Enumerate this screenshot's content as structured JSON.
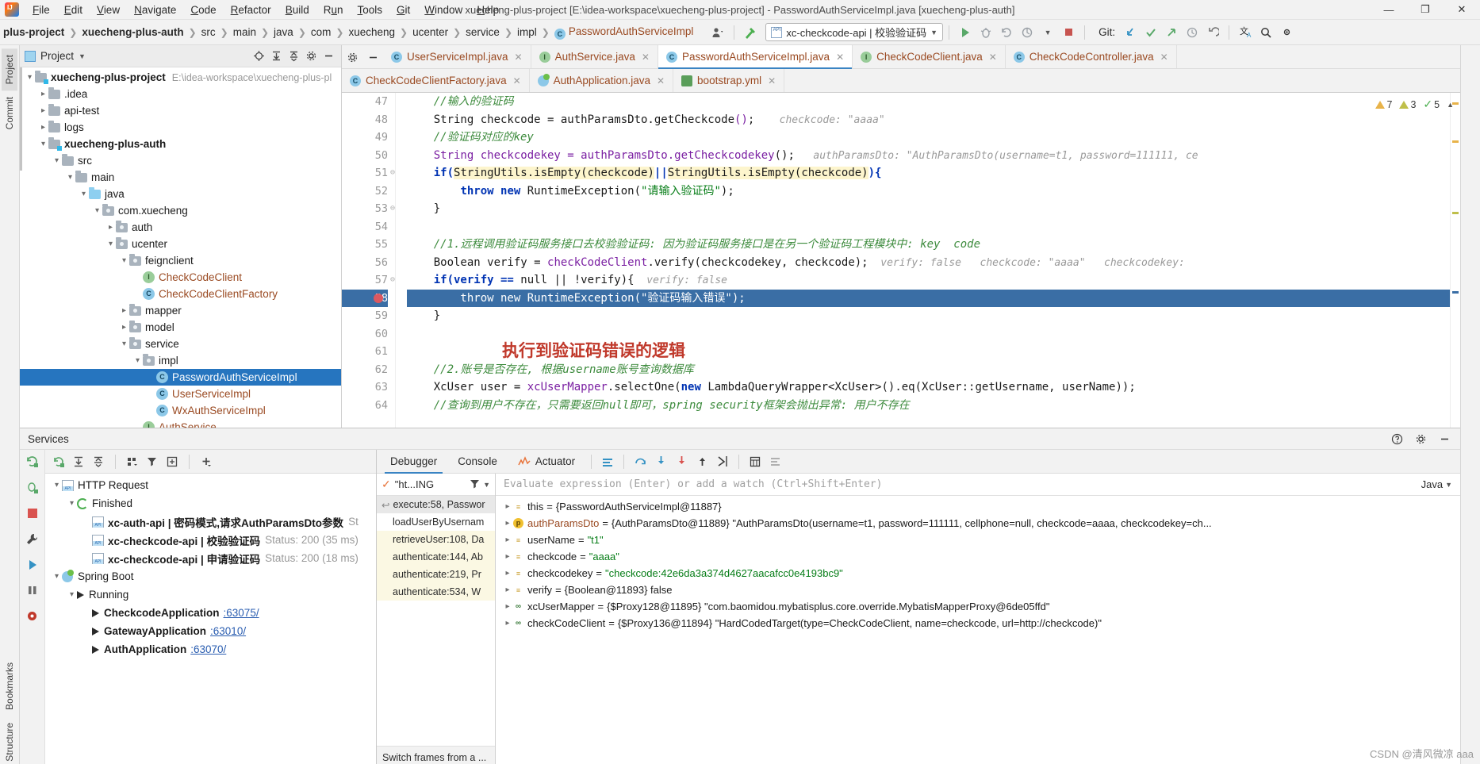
{
  "window": {
    "title": "xuecheng-plus-project [E:\\idea-workspace\\xuecheng-plus-project] - PasswordAuthServiceImpl.java [xuecheng-plus-auth]",
    "minimize": "—",
    "maximize": "❐",
    "close": "✕"
  },
  "menu": [
    "File",
    "Edit",
    "View",
    "Navigate",
    "Code",
    "Refactor",
    "Build",
    "Run",
    "Tools",
    "Git",
    "Window",
    "Help"
  ],
  "breadcrumbs": [
    {
      "label": "plus-project",
      "bold": true
    },
    {
      "label": "xuecheng-plus-auth",
      "bold": true
    },
    {
      "label": "src"
    },
    {
      "label": "main"
    },
    {
      "label": "java"
    },
    {
      "label": "com"
    },
    {
      "label": "xuecheng"
    },
    {
      "label": "ucenter"
    },
    {
      "label": "service"
    },
    {
      "label": "impl"
    },
    {
      "label": "PasswordAuthServiceImpl",
      "icon": "class-icon",
      "cls": true
    }
  ],
  "toolbar": {
    "run_config": "xc-checkcode-api | 校验验证码",
    "run_tooltip": "Run",
    "debug_tooltip": "Debug",
    "git_label": "Git:",
    "icons": [
      "avatar-icon",
      "hammer-icon",
      "run-icon",
      "debug-icon",
      "rerun-icon",
      "coverage-icon",
      "stop-icon",
      "git-update-icon",
      "git-commit-icon",
      "git-push-icon",
      "git-history-icon",
      "git-rollback-icon",
      "translate-icon",
      "search-icon"
    ]
  },
  "left_strip": {
    "project_tab": "Project",
    "commit_tab": "Commit",
    "bookmarks_tab": "Bookmarks",
    "structure_tab": "Structure"
  },
  "project_panel": {
    "title": "Project",
    "actions": [
      "locate-icon",
      "expand-all-icon",
      "collapse-all-icon",
      "settings-icon",
      "hide-icon"
    ],
    "tree": [
      {
        "depth": 0,
        "twist": "v",
        "icon": "folder-module",
        "label": "xuecheng-plus-project",
        "bold": true,
        "path": "E:\\idea-workspace\\xuecheng-plus-pl"
      },
      {
        "depth": 1,
        "twist": ">",
        "icon": "folder",
        "label": ".idea"
      },
      {
        "depth": 1,
        "twist": ">",
        "icon": "folder",
        "label": "api-test"
      },
      {
        "depth": 1,
        "twist": ">",
        "icon": "folder",
        "label": "logs"
      },
      {
        "depth": 1,
        "twist": "v",
        "icon": "folder-module",
        "label": "xuecheng-plus-auth",
        "bold": true
      },
      {
        "depth": 2,
        "twist": "v",
        "icon": "folder",
        "label": "src"
      },
      {
        "depth": 3,
        "twist": "v",
        "icon": "folder",
        "label": "main"
      },
      {
        "depth": 4,
        "twist": "v",
        "icon": "folder-source",
        "label": "java"
      },
      {
        "depth": 5,
        "twist": "v",
        "icon": "folder-package",
        "label": "com.xuecheng"
      },
      {
        "depth": 6,
        "twist": ">",
        "icon": "folder-package",
        "label": "auth"
      },
      {
        "depth": 6,
        "twist": "v",
        "icon": "folder-package",
        "label": "ucenter"
      },
      {
        "depth": 7,
        "twist": "v",
        "icon": "folder-package",
        "label": "feignclient"
      },
      {
        "depth": 8,
        "twist": "",
        "icon": "interface-icon",
        "label": "CheckCodeClient",
        "cls": true
      },
      {
        "depth": 8,
        "twist": "",
        "icon": "class-icon",
        "label": "CheckCodeClientFactory",
        "cls": true
      },
      {
        "depth": 7,
        "twist": ">",
        "icon": "folder-package",
        "label": "mapper"
      },
      {
        "depth": 7,
        "twist": ">",
        "icon": "folder-package",
        "label": "model"
      },
      {
        "depth": 7,
        "twist": "v",
        "icon": "folder-package",
        "label": "service"
      },
      {
        "depth": 8,
        "twist": "v",
        "icon": "folder-package",
        "label": "impl"
      },
      {
        "depth": 9,
        "twist": "",
        "icon": "class-icon",
        "label": "PasswordAuthServiceImpl",
        "cls": true,
        "selected": true
      },
      {
        "depth": 9,
        "twist": "",
        "icon": "class-icon",
        "label": "UserServiceImpl",
        "cls": true
      },
      {
        "depth": 9,
        "twist": "",
        "icon": "class-icon",
        "label": "WxAuthServiceImpl",
        "cls": true
      },
      {
        "depth": 8,
        "twist": "",
        "icon": "interface-icon",
        "label": "AuthService",
        "cls": true
      }
    ]
  },
  "editor_tabs_row1": [
    {
      "label": "UserServiceImpl.java",
      "icon": "class-icon",
      "active": false
    },
    {
      "label": "AuthService.java",
      "icon": "interface-icon",
      "active": false
    },
    {
      "label": "PasswordAuthServiceImpl.java",
      "icon": "class-icon",
      "active": true
    },
    {
      "label": "CheckCodeClient.java",
      "icon": "interface-icon",
      "active": false
    },
    {
      "label": "CheckCodeController.java",
      "icon": "class-icon",
      "active": false
    }
  ],
  "editor_tabs_row2": [
    {
      "label": "CheckCodeClientFactory.java",
      "icon": "class-icon",
      "active": false
    },
    {
      "label": "AuthApplication.java",
      "icon": "spring-icon",
      "active": false
    },
    {
      "label": "bootstrap.yml",
      "icon": "yml-icon",
      "active": false
    }
  ],
  "inspections": {
    "warnings": "7",
    "weak_warnings": "3",
    "typos": "5"
  },
  "code": {
    "first_line": 47,
    "lines": [
      {
        "n": 47,
        "segments": [
          {
            "t": "    ",
            "c": "plain"
          },
          {
            "t": "//输入的验证码",
            "c": "cmt"
          }
        ]
      },
      {
        "n": 48,
        "segments": [
          {
            "t": "    String checkcode = authParamsDto.getCheckcode",
            "c": "plain"
          },
          {
            "t": "()",
            "c": "meth"
          },
          {
            "t": ";",
            "c": "plain"
          },
          {
            "t": "    checkcode: \"aaaa\"",
            "c": "hint"
          }
        ]
      },
      {
        "n": 49,
        "segments": [
          {
            "t": "    ",
            "c": "plain"
          },
          {
            "t": "//验证码对应的key",
            "c": "cmt"
          }
        ]
      },
      {
        "n": 50,
        "segments": [
          {
            "t": "    String checkcodekey = authParamsDto.getCheckcodekey",
            "c": "meth"
          },
          {
            "t": "();",
            "c": "plain"
          },
          {
            "t": "   authParamsDto: \"AuthParamsDto(username=t1, password=111111, ce",
            "c": "hint"
          }
        ]
      },
      {
        "n": 51,
        "segments": [
          {
            "t": "    if(",
            "c": "kw"
          },
          {
            "t": "StringUtils.isEmpty(checkcode)",
            "c": "warn"
          },
          {
            "t": "||",
            "c": "kw"
          },
          {
            "t": "StringUtils.isEmpty(checkcode)",
            "c": "warn"
          },
          {
            "t": "){",
            "c": "kw"
          }
        ],
        "fold": true
      },
      {
        "n": 52,
        "segments": [
          {
            "t": "        ",
            "c": "plain"
          },
          {
            "t": "throw new ",
            "c": "kw"
          },
          {
            "t": "RuntimeException(",
            "c": "plain"
          },
          {
            "t": "\"请输入验证码\"",
            "c": "str"
          },
          {
            "t": ");",
            "c": "plain"
          }
        ]
      },
      {
        "n": 53,
        "segments": [
          {
            "t": "    }",
            "c": "plain"
          }
        ],
        "fold": true
      },
      {
        "n": 54,
        "segments": []
      },
      {
        "n": 55,
        "segments": [
          {
            "t": "    ",
            "c": "plain"
          },
          {
            "t": "//1.远程调用验证码服务接口去校验验证码: 因为验证码服务接口是在另一个验证码工程模块中: key  code",
            "c": "cmt"
          }
        ]
      },
      {
        "n": 56,
        "segments": [
          {
            "t": "    Boolean verify = ",
            "c": "plain"
          },
          {
            "t": "checkCodeClient",
            "c": "meth"
          },
          {
            "t": ".verify(checkcodekey, checkcode);",
            "c": "plain"
          },
          {
            "t": "  verify: false   checkcode: \"aaaa\"   checkcodekey:",
            "c": "hint"
          }
        ]
      },
      {
        "n": 57,
        "segments": [
          {
            "t": "    if(verify == ",
            "c": "kw"
          },
          {
            "t": "null || !verify){",
            "c": "plain"
          },
          {
            "t": "  verify: false",
            "c": "hint"
          }
        ],
        "fold": true
      },
      {
        "n": 58,
        "segments": [
          {
            "t": "        throw new RuntimeException(\"验证码输入错误\");",
            "c": "selline"
          }
        ],
        "highlight": true,
        "breakpoint": true
      },
      {
        "n": 59,
        "segments": [
          {
            "t": "    }",
            "c": "plain"
          }
        ]
      },
      {
        "n": 60,
        "segments": []
      },
      {
        "n": 61,
        "segments": [],
        "annotation": "执行到验证码错误的逻辑"
      },
      {
        "n": 62,
        "segments": [
          {
            "t": "    ",
            "c": "plain"
          },
          {
            "t": "//2.账号是否存在, 根据username账号查询数据库",
            "c": "cmt"
          }
        ]
      },
      {
        "n": 63,
        "segments": [
          {
            "t": "    XcUser user = ",
            "c": "plain"
          },
          {
            "t": "xcUserMapper",
            "c": "meth"
          },
          {
            "t": ".selectOne(",
            "c": "plain"
          },
          {
            "t": "new ",
            "c": "kw"
          },
          {
            "t": "LambdaQueryWrapper<XcUser>().eq(XcUser::getUsername, userName));",
            "c": "plain"
          }
        ]
      },
      {
        "n": 64,
        "segments": [
          {
            "t": "    ",
            "c": "plain"
          },
          {
            "t": "//查询到用户不存在，只需要返回null即可，spring security框架会抛出异常: 用户不存在",
            "c": "cmt"
          }
        ]
      }
    ]
  },
  "services": {
    "header": "Services",
    "toolbar_icons": [
      "rerun-icon",
      "expand-all-icon",
      "collapse-all-icon",
      "group-icon",
      "filter-icon",
      "new-tab-icon",
      "add-icon"
    ],
    "strip_icons": [
      "rerun-icon",
      "debug-icon",
      "stop-icon",
      "settings-icon",
      "run-icon",
      "pause-icon",
      "camera-icon"
    ],
    "tree": [
      {
        "depth": 0,
        "twist": "v",
        "icon": "api-icon",
        "label": "HTTP Request",
        "bold": false
      },
      {
        "depth": 1,
        "twist": "v",
        "icon": "run-circle-icon",
        "label": "Finished",
        "bold": false
      },
      {
        "depth": 2,
        "twist": "",
        "icon": "api-icon",
        "label": "xc-auth-api | 密码模式,请求AuthParamsDto参数",
        "bold": true,
        "status": "St"
      },
      {
        "depth": 2,
        "twist": "",
        "icon": "api-icon",
        "label": "xc-checkcode-api | 校验验证码",
        "bold": true,
        "status": "Status: 200 (35 ms)"
      },
      {
        "depth": 2,
        "twist": "",
        "icon": "api-icon",
        "label": "xc-checkcode-api | 申请验证码",
        "bold": true,
        "status": "Status: 200 (18 ms)"
      },
      {
        "depth": 0,
        "twist": "v",
        "icon": "spring-icon",
        "label": "Spring Boot",
        "bold": false
      },
      {
        "depth": 1,
        "twist": "v",
        "icon": "play-icon",
        "label": "Running",
        "bold": false
      },
      {
        "depth": 2,
        "twist": "",
        "icon": "play-icon",
        "label": "CheckcodeApplication",
        "bold": true,
        "port": ":63075/"
      },
      {
        "depth": 2,
        "twist": "",
        "icon": "play-icon",
        "label": "GatewayApplication",
        "bold": true,
        "port": ":63010/"
      },
      {
        "depth": 2,
        "twist": "",
        "icon": "debug-icon",
        "label": "AuthApplication",
        "bold": true,
        "port": ":63070/"
      }
    ]
  },
  "debugger": {
    "tabs": [
      "Debugger",
      "Console",
      "Actuator"
    ],
    "active_tab": "Debugger",
    "toolbar_icons": [
      "mute-breakpoints-icon",
      "step-over-icon",
      "step-into-icon",
      "force-step-into-icon",
      "step-out-icon",
      "run-to-cursor-icon",
      "evaluate-icon",
      "settings-icon"
    ],
    "frames_header": "\"ht...ING",
    "frames_filter_icon": "filter-icon",
    "frames": [
      {
        "label": "execute:58, Passwor",
        "state": "current"
      },
      {
        "label": "loadUserByUsernam",
        "state": "normal"
      },
      {
        "label": "retrieveUser:108, Da",
        "state": "yellow"
      },
      {
        "label": "authenticate:144, Ab",
        "state": "yellow"
      },
      {
        "label": "authenticate:219, Pr",
        "state": "yellow"
      },
      {
        "label": "authenticate:534, W",
        "state": "yellow"
      }
    ],
    "frames_footer": "Switch frames from a ...",
    "eval_placeholder": "Evaluate expression (Enter) or add a watch (Ctrl+Shift+Enter)",
    "lang_selector": "Java",
    "variables": [
      {
        "twist": ">",
        "icon": "field-icon",
        "name": "this",
        "value": "{PasswordAuthServiceImpl@11887}",
        "vtype": "ref"
      },
      {
        "twist": ">",
        "icon": "param-icon",
        "name": "authParamsDto",
        "name_red": true,
        "value": "{AuthParamsDto@11889} \"AuthParamsDto(username=t1, password=111111, cellphone=null, checkcode=aaaa, checkcodekey=ch...",
        "vtype": "mixed"
      },
      {
        "twist": ">",
        "icon": "field-icon",
        "name": "userName",
        "value": "\"t1\"",
        "vtype": "str"
      },
      {
        "twist": ">",
        "icon": "field-icon",
        "name": "checkcode",
        "value": "\"aaaa\"",
        "vtype": "str"
      },
      {
        "twist": ">",
        "icon": "field-icon",
        "name": "checkcodekey",
        "value": "\"checkcode:42e6da3a374d4627aacafcc0e4193bc9\"",
        "vtype": "str"
      },
      {
        "twist": ">",
        "icon": "field-icon",
        "name": "verify",
        "value": "{Boolean@11893} false",
        "vtype": "ref"
      },
      {
        "twist": ">",
        "icon": "oo-icon",
        "name": "xcUserMapper",
        "value": "{$Proxy128@11895} \"com.baomidou.mybatisplus.core.override.MybatisMapperProxy@6de05ffd\"",
        "vtype": "ref"
      },
      {
        "twist": ">",
        "icon": "oo-icon",
        "name": "checkCodeClient",
        "value": "{$Proxy136@11894} \"HardCodedTarget(type=CheckCodeClient, name=checkcode, url=http://checkcode)\"",
        "vtype": "ref"
      }
    ]
  },
  "watermark": "CSDN @清风微凉 aaa"
}
